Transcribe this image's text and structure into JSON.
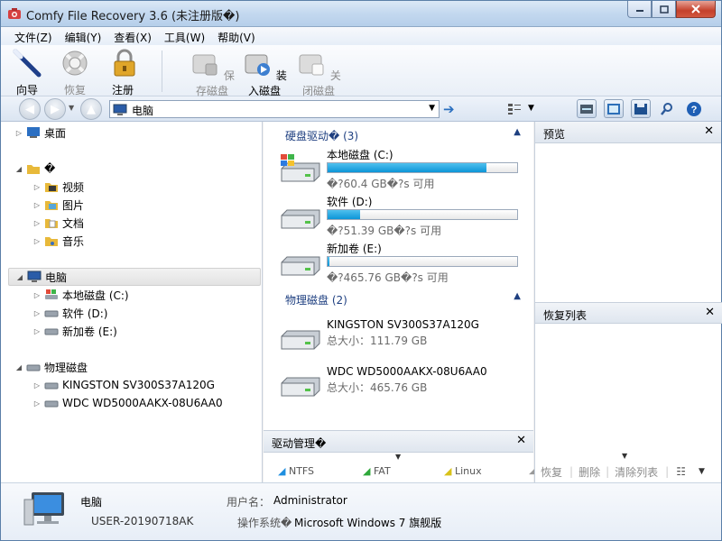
{
  "window": {
    "title": "Comfy File Recovery 3.6 (未注册版�)"
  },
  "menu": [
    "文件(Z)",
    "编辑(Y)",
    "查看(X)",
    "工具(W)",
    "帮助(V)"
  ],
  "toolbar": {
    "wizard": "向导",
    "restore": "恢复",
    "register": "注册",
    "save_disk": "保存磁盘",
    "load_disk": "装入磁盘",
    "close_disk": "关闭磁盘"
  },
  "address": {
    "value": "电脑"
  },
  "tree": {
    "desktop": "桌面",
    "user_folder": "�",
    "videos": "视频",
    "pictures": "图片",
    "documents": "文档",
    "music": "音乐",
    "computer": "电脑",
    "drive_c": "本地磁盘 (C:)",
    "drive_d": "软件 (D:)",
    "drive_e": "新加卷 (E:)",
    "physical": "物理磁盘",
    "disk1": "KINGSTON SV300S37A120G",
    "disk2": "WDC WD5000AAKX-08U6AA0"
  },
  "drives_group": {
    "title": "硬盘驱动� (3)"
  },
  "drives": [
    {
      "name": "本地磁盘 (C:)",
      "free": "�?60.4 GB�?s 可用",
      "used_fraction": 0.84
    },
    {
      "name": "软件 (D:)",
      "free": "�?51.39 GB�?s 可用",
      "used_fraction": 0.17
    },
    {
      "name": "新加卷 (E:)",
      "free": "�?465.76 GB�?s 可用",
      "used_fraction": 0.01
    }
  ],
  "physical_group": {
    "title": "物理磁盘 (2)"
  },
  "physical_disks": [
    {
      "name": "KINGSTON SV300S37A120G",
      "size": "总大小：111.79 GB"
    },
    {
      "name": "WDC WD5000AAKX-08U6AA0",
      "size": "总大小：465.76 GB"
    }
  ],
  "drive_manager": {
    "title": "驱动管理�",
    "fs": [
      "NTFS",
      "FAT",
      "Linux"
    ]
  },
  "preview": {
    "title": "预览"
  },
  "recovery_list": {
    "title": "恢复列表"
  },
  "right_tools": {
    "restore": "恢复",
    "delete": "删除",
    "clear": "清除列表"
  },
  "status": {
    "computer": "电脑",
    "machine": "USER-20190718AK",
    "user_label": "用户名：",
    "user": "Administrator",
    "os_label": "操作系统�",
    "os": "Microsoft Windows 7 旗舰版"
  },
  "colors": {
    "accent": "#1e3f80",
    "bar_fill": "#0c95d7",
    "close_button": "#c4402b"
  }
}
